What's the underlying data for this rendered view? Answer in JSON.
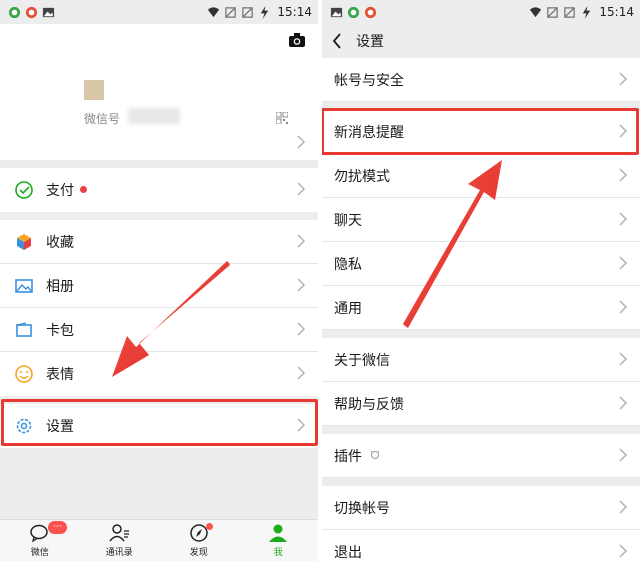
{
  "status_bar": {
    "time": "15:14"
  },
  "left": {
    "profile": {
      "wechat_id_label": "微信号"
    },
    "pay": {
      "label": "支付"
    },
    "menu": [
      {
        "label": "收藏",
        "icon": "cube-icon"
      },
      {
        "label": "相册",
        "icon": "photo-icon"
      },
      {
        "label": "卡包",
        "icon": "card-icon"
      },
      {
        "label": "表情",
        "icon": "smile-icon"
      }
    ],
    "settings": {
      "label": "设置"
    },
    "tabs": [
      {
        "label": "微信",
        "badge": "···"
      },
      {
        "label": "通讯录"
      },
      {
        "label": "发现"
      },
      {
        "label": "我"
      }
    ]
  },
  "right": {
    "title": "设置",
    "items": [
      "帐号与安全",
      "新消息提醒",
      "勿扰模式",
      "聊天",
      "隐私",
      "通用",
      "关于微信",
      "帮助与反馈",
      "插件",
      "切换帐号",
      "退出"
    ]
  },
  "colors": {
    "accent_green": "#1aad19",
    "highlight_red": "#e83a33",
    "badge_red": "#fa5151",
    "background": "#ededed"
  }
}
